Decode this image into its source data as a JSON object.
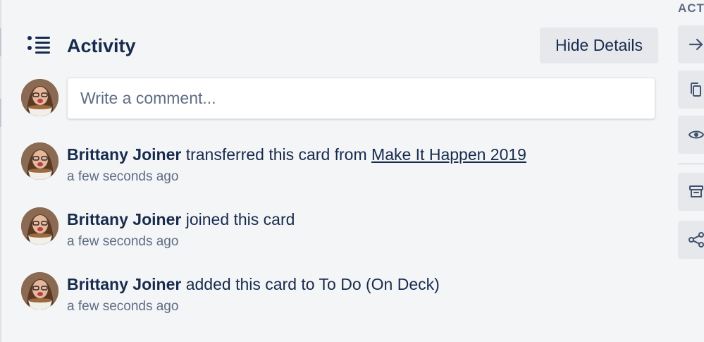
{
  "activity": {
    "title": "Activity",
    "hide_details_label": "Hide Details"
  },
  "comment": {
    "placeholder": "Write a comment..."
  },
  "entries": [
    {
      "member": "Brittany Joiner",
      "action": " transferred this card from ",
      "link_text": "Make It Happen 2019",
      "time": "a few seconds ago"
    },
    {
      "member": "Brittany Joiner",
      "action": " joined this card",
      "time": "a few seconds ago"
    },
    {
      "member": "Brittany Joiner",
      "action": " added this card to To Do (On Deck)",
      "time": "a few seconds ago"
    }
  ],
  "sidebar": {
    "heading": "ACTIONS",
    "buttons": [
      {
        "icon": "arrow-right-icon"
      },
      {
        "icon": "copy-icon"
      },
      {
        "icon": "eye-icon"
      },
      {
        "icon": "archive-icon"
      },
      {
        "icon": "share-icon"
      }
    ]
  }
}
